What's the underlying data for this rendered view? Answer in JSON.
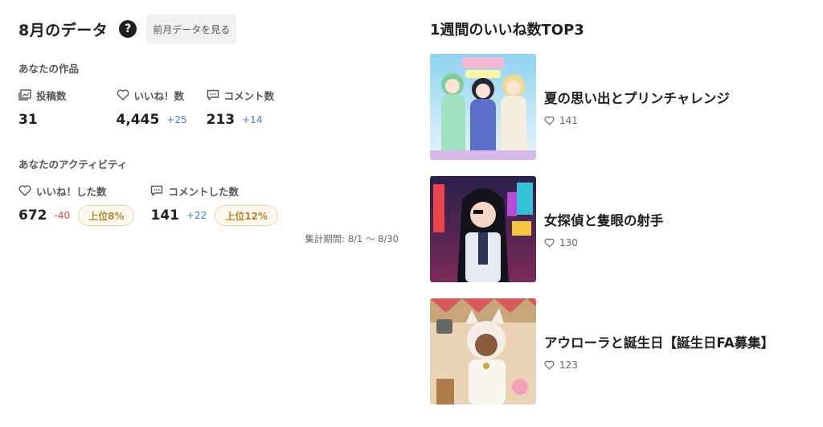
{
  "stats": {
    "title": "8月のデータ",
    "help_icon": "question-circle-icon",
    "prev_button": "前月データを見る",
    "works": {
      "label": "あなたの作品",
      "posts": {
        "icon": "folder-image-icon",
        "label": "投稿数",
        "value": "31"
      },
      "likes": {
        "icon": "heart-outline-icon",
        "label": "いいね！数",
        "value": "4,445",
        "delta": "+25"
      },
      "comments": {
        "icon": "comment-outline-icon",
        "label": "コメント数",
        "value": "213",
        "delta": "+14"
      }
    },
    "activity": {
      "label": "あなたのアクティビティ",
      "liked": {
        "icon": "heart-outline-icon",
        "label": "いいね！した数",
        "value": "672",
        "delta": "-40",
        "rank": "上位8%"
      },
      "commented": {
        "icon": "comment-outline-icon",
        "label": "コメントした数",
        "value": "141",
        "delta": "+22",
        "rank": "上位12%"
      }
    },
    "period": "集計期間: 8/1 〜 8/30"
  },
  "ranking": {
    "title": "1週間のいいね数TOP3",
    "items": [
      {
        "title": "夏の思い出とプリンチャレンジ",
        "likes": "141",
        "thumb": "three-anime-girls-summer-festival"
      },
      {
        "title": "女探偵と隻眼の射手",
        "likes": "130",
        "thumb": "detective-girl-eyepatch-neon-city"
      },
      {
        "title": "アウローラと誕生日【誕生日FA募集】",
        "likes": "123",
        "thumb": "white-haired-cat-girl-birthday"
      }
    ]
  },
  "colors": {
    "plus": "#3d7bd9",
    "minus": "#e04848",
    "rank_badge_text": "#b7862c",
    "rank_badge_border": "#e8d3a6"
  }
}
